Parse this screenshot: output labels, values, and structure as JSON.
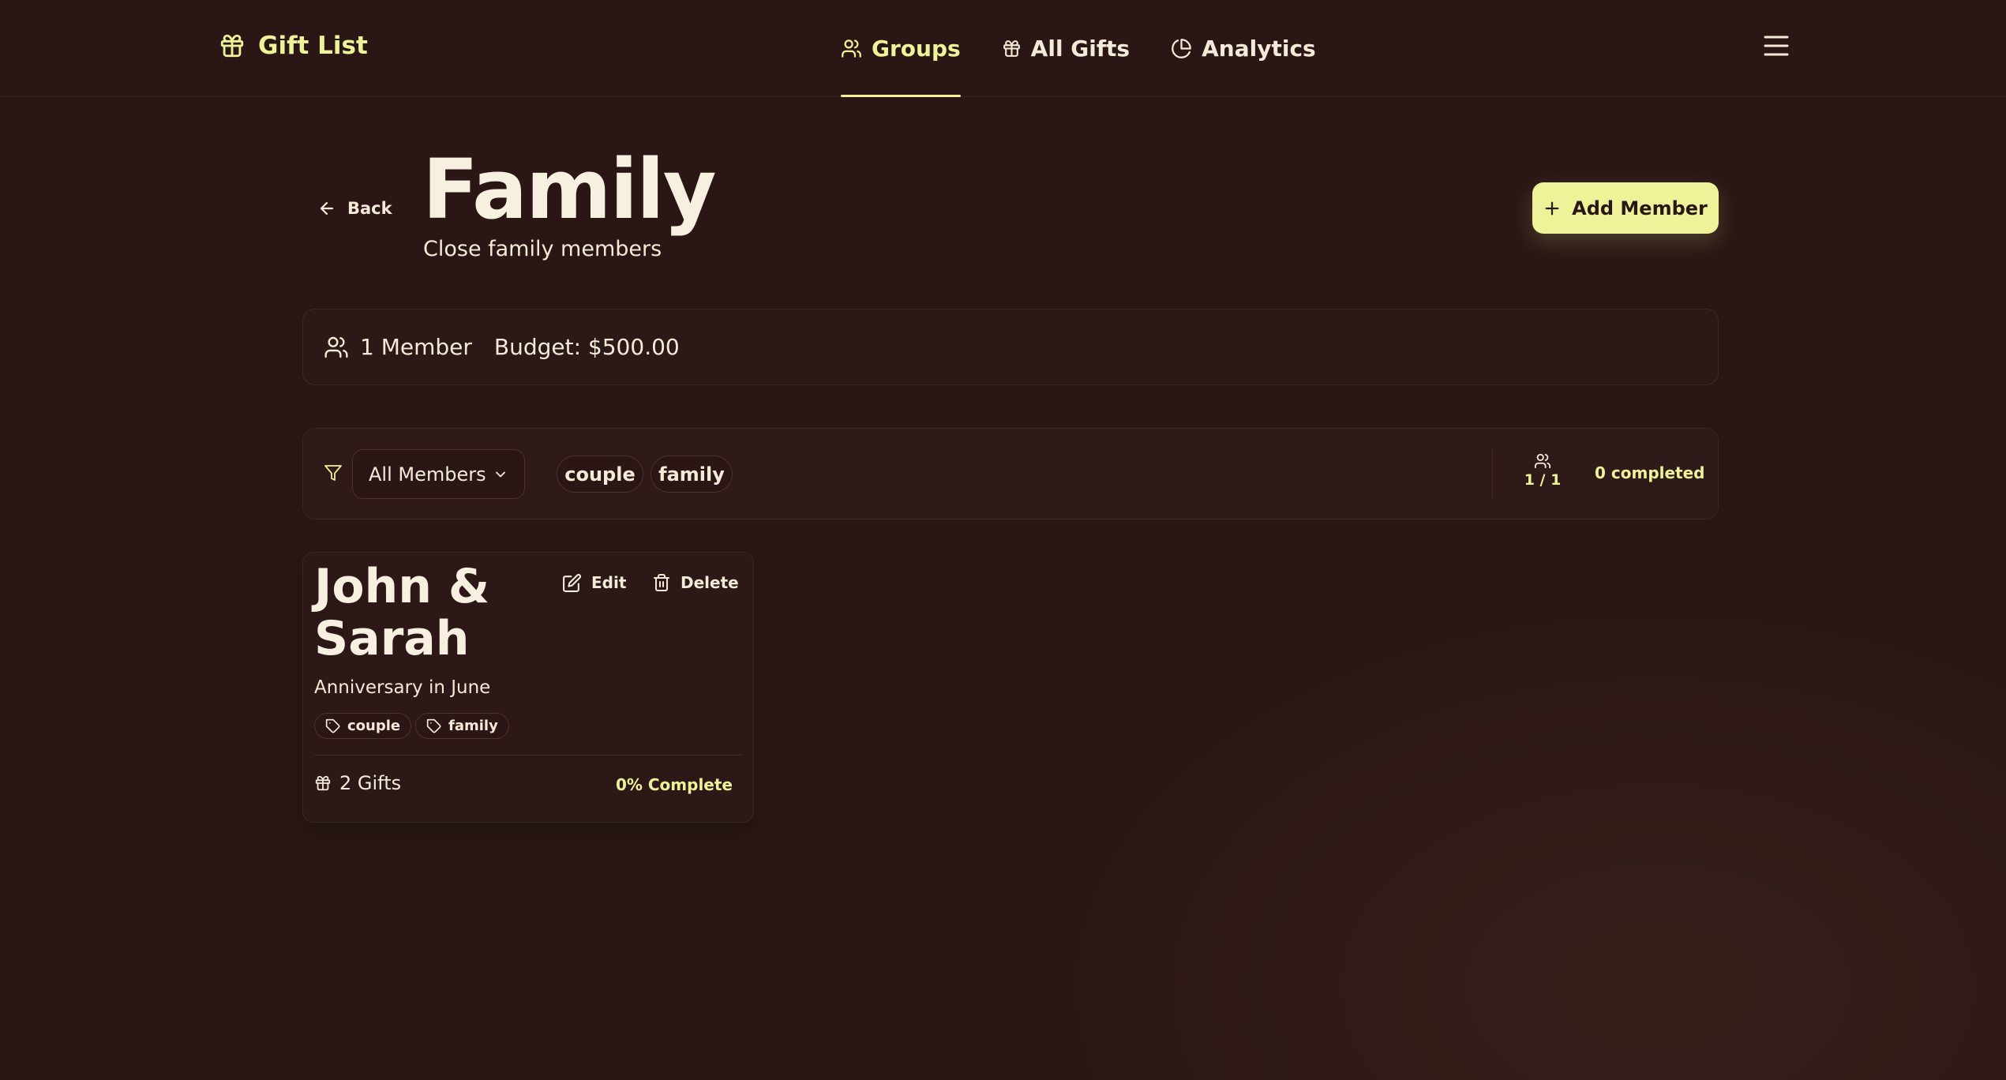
{
  "brand": {
    "name": "Gift List"
  },
  "nav": {
    "items": [
      {
        "label": "Groups",
        "icon": "users-icon",
        "active": true
      },
      {
        "label": "All Gifts",
        "icon": "gift-icon",
        "active": false
      },
      {
        "label": "Analytics",
        "icon": "pie-chart-icon",
        "active": false
      }
    ]
  },
  "page": {
    "back_label": "Back",
    "title": "Family",
    "subtitle": "Close family members",
    "add_member_label": "Add Member"
  },
  "stats": {
    "members": "1 Member",
    "budget": "Budget: $500.00"
  },
  "filter": {
    "selected": "All Members",
    "tags": [
      "couple",
      "family"
    ],
    "progress": "1 / 1",
    "completed": "0 completed"
  },
  "members": [
    {
      "name": "John & Sarah",
      "description": "Anniversary in June",
      "tags": [
        "couple",
        "family"
      ],
      "gifts": "2 Gifts",
      "complete": "0% Complete",
      "edit_label": "Edit",
      "delete_label": "Delete"
    }
  ],
  "colors": {
    "background": "#2a1715",
    "accent": "#eef39a",
    "text": "#f3ead8",
    "border": "#3a2622"
  }
}
